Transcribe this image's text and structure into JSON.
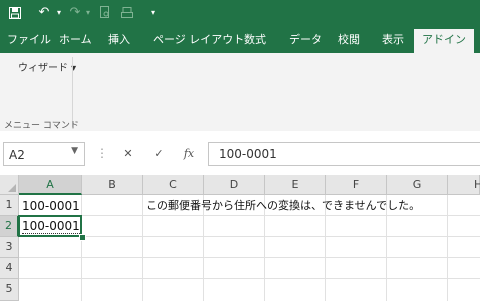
{
  "quick_access": {
    "save_icon": "save-icon",
    "undo_icon": "undo-icon",
    "redo_icon": "redo-icon",
    "customize_icon": "customize-qat-icon"
  },
  "tabs": [
    "ファイル",
    "ホーム",
    "挿入",
    "ページ レイアウト",
    "数式",
    "データ",
    "校閲",
    "表示",
    "アドイン"
  ],
  "active_tab": "アドイン",
  "ribbon": {
    "wizard_label": "ウィザード ▾",
    "group_label": "メニュー コマンド"
  },
  "formula_bar": {
    "name_box": "A2",
    "cancel_glyph": "✕",
    "enter_glyph": "✓",
    "function_glyph": "fx",
    "formula_value": "100-0001"
  },
  "sheet": {
    "columns": [
      "A",
      "B",
      "C",
      "D",
      "E",
      "F",
      "G",
      "H"
    ],
    "rows": [
      "1",
      "2",
      "3",
      "4",
      "5"
    ],
    "cells": {
      "A1": "100-0001",
      "C1": "この郵便番号から住所への変換は、できませんでした。",
      "A2": "100-0001"
    },
    "selected_column": "A",
    "selected_row": "2",
    "active_cell": "A2"
  },
  "colors": {
    "excel_green": "#217346",
    "ribbon_bg": "#f3f3f3",
    "header_bg": "#e6e6e6"
  }
}
